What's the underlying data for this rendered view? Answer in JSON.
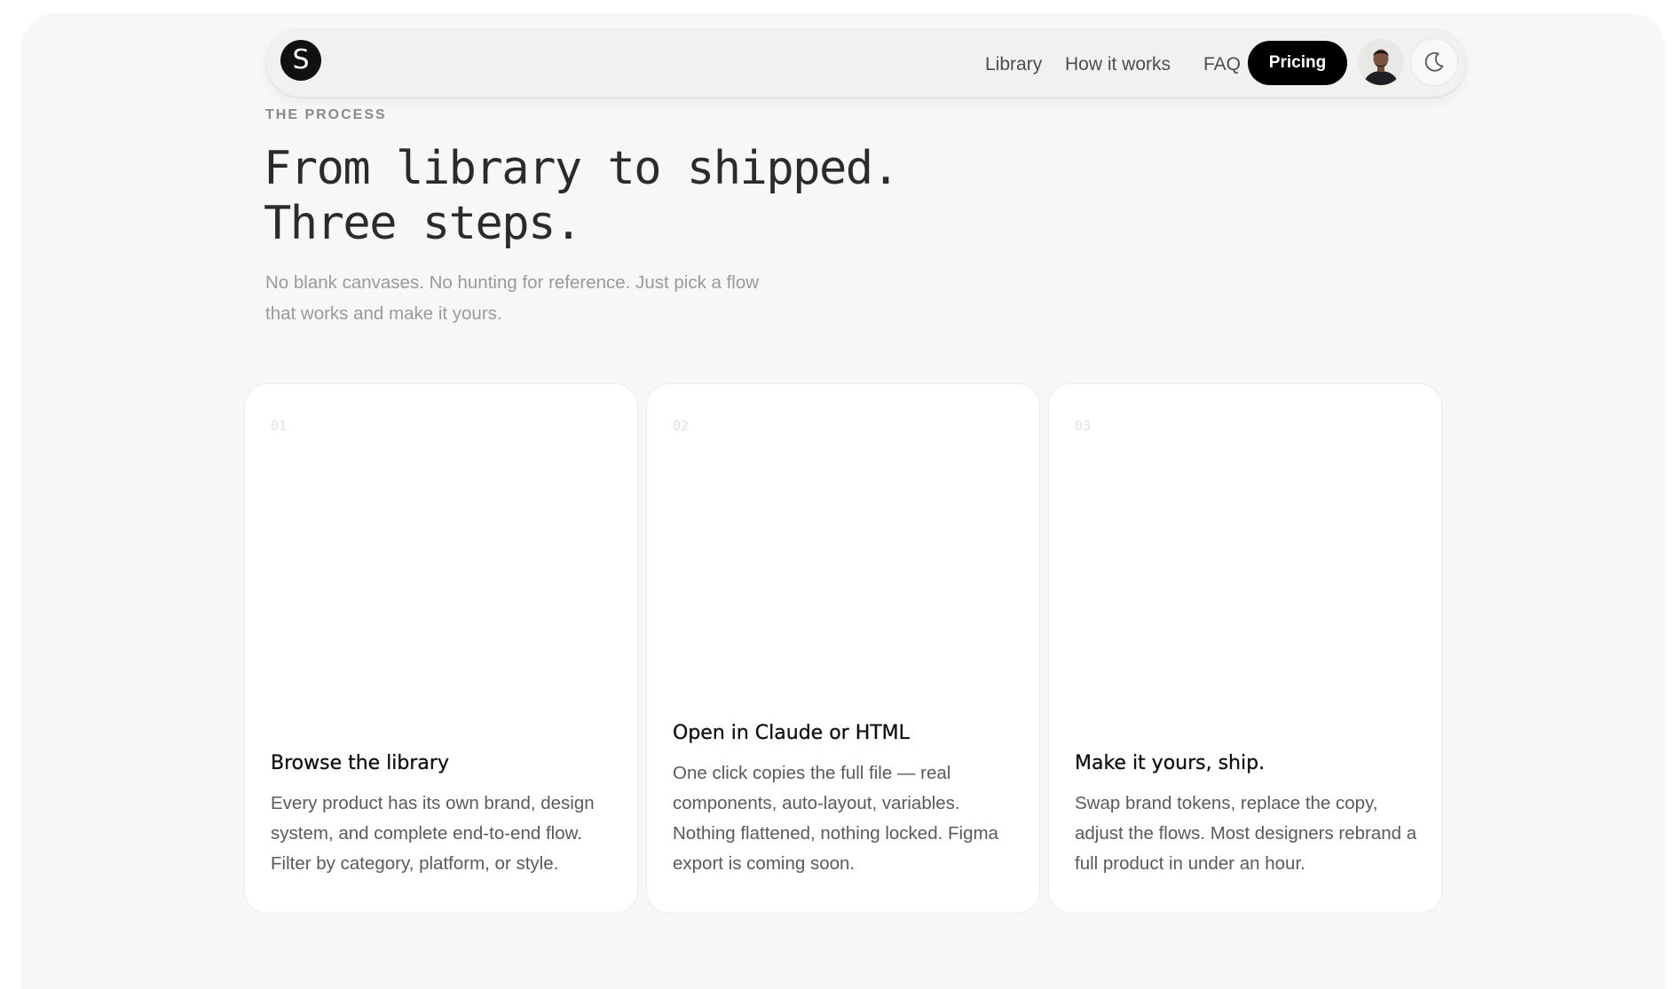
{
  "nav": {
    "logo_letter": "S",
    "links": [
      "Library",
      "How it works",
      "FAQ"
    ],
    "pricing_label": "Pricing"
  },
  "section": {
    "eyebrow": "THE PROCESS",
    "headline_line1": "From library to shipped.",
    "headline_line2": "Three steps.",
    "subtitle": "No blank canvases. No hunting for reference. Just pick a flow that works and make it yours."
  },
  "steps": [
    {
      "number": "01",
      "title": "Browse the library",
      "description": "Every product has its own brand, design system, and complete end-to-end flow. Filter by category, platform, or style."
    },
    {
      "number": "02",
      "title": "Open in Claude or HTML",
      "description": "One click copies the full file — real components, auto-layout, variables. Nothing flattened, nothing locked. Figma export is coming soon."
    },
    {
      "number": "03",
      "title": "Make it yours, ship.",
      "description": "Swap brand tokens, replace the copy, adjust the flows. Most designers rebrand a full product in under an hour."
    }
  ],
  "icons": {
    "theme_toggle": "moon-icon",
    "avatar": "user-avatar"
  },
  "colors": {
    "page_bg": "#f7f7f6",
    "accent": "#000000",
    "card_bg": "#ffffff"
  }
}
